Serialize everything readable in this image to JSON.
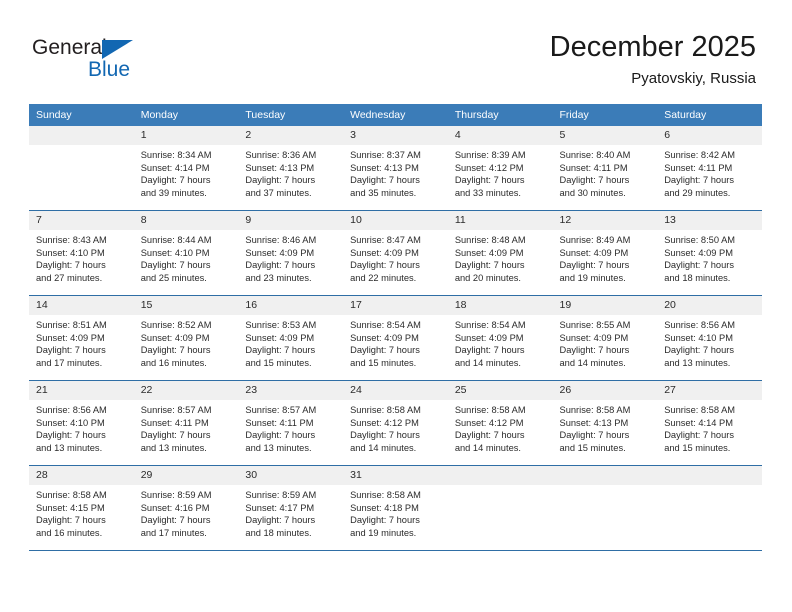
{
  "brand": {
    "name_part1": "General",
    "name_part2": "Blue",
    "accent_color": "#1267b2"
  },
  "header": {
    "title": "December 2025",
    "subtitle": "Pyatovskiy, Russia"
  },
  "calendar": {
    "header_bg": "#3b7cb8",
    "daynum_bg": "#f0f0f0",
    "separator_color": "#2f6ea5",
    "weekday_headers": [
      "Sunday",
      "Monday",
      "Tuesday",
      "Wednesday",
      "Thursday",
      "Friday",
      "Saturday"
    ],
    "weeks": [
      [
        {
          "day": "",
          "sunrise": "",
          "sunset": "",
          "daylight_line1": "",
          "daylight_line2": ""
        },
        {
          "day": "1",
          "sunrise": "Sunrise: 8:34 AM",
          "sunset": "Sunset: 4:14 PM",
          "daylight_line1": "Daylight: 7 hours",
          "daylight_line2": "and 39 minutes."
        },
        {
          "day": "2",
          "sunrise": "Sunrise: 8:36 AM",
          "sunset": "Sunset: 4:13 PM",
          "daylight_line1": "Daylight: 7 hours",
          "daylight_line2": "and 37 minutes."
        },
        {
          "day": "3",
          "sunrise": "Sunrise: 8:37 AM",
          "sunset": "Sunset: 4:13 PM",
          "daylight_line1": "Daylight: 7 hours",
          "daylight_line2": "and 35 minutes."
        },
        {
          "day": "4",
          "sunrise": "Sunrise: 8:39 AM",
          "sunset": "Sunset: 4:12 PM",
          "daylight_line1": "Daylight: 7 hours",
          "daylight_line2": "and 33 minutes."
        },
        {
          "day": "5",
          "sunrise": "Sunrise: 8:40 AM",
          "sunset": "Sunset: 4:11 PM",
          "daylight_line1": "Daylight: 7 hours",
          "daylight_line2": "and 30 minutes."
        },
        {
          "day": "6",
          "sunrise": "Sunrise: 8:42 AM",
          "sunset": "Sunset: 4:11 PM",
          "daylight_line1": "Daylight: 7 hours",
          "daylight_line2": "and 29 minutes."
        }
      ],
      [
        {
          "day": "7",
          "sunrise": "Sunrise: 8:43 AM",
          "sunset": "Sunset: 4:10 PM",
          "daylight_line1": "Daylight: 7 hours",
          "daylight_line2": "and 27 minutes."
        },
        {
          "day": "8",
          "sunrise": "Sunrise: 8:44 AM",
          "sunset": "Sunset: 4:10 PM",
          "daylight_line1": "Daylight: 7 hours",
          "daylight_line2": "and 25 minutes."
        },
        {
          "day": "9",
          "sunrise": "Sunrise: 8:46 AM",
          "sunset": "Sunset: 4:09 PM",
          "daylight_line1": "Daylight: 7 hours",
          "daylight_line2": "and 23 minutes."
        },
        {
          "day": "10",
          "sunrise": "Sunrise: 8:47 AM",
          "sunset": "Sunset: 4:09 PM",
          "daylight_line1": "Daylight: 7 hours",
          "daylight_line2": "and 22 minutes."
        },
        {
          "day": "11",
          "sunrise": "Sunrise: 8:48 AM",
          "sunset": "Sunset: 4:09 PM",
          "daylight_line1": "Daylight: 7 hours",
          "daylight_line2": "and 20 minutes."
        },
        {
          "day": "12",
          "sunrise": "Sunrise: 8:49 AM",
          "sunset": "Sunset: 4:09 PM",
          "daylight_line1": "Daylight: 7 hours",
          "daylight_line2": "and 19 minutes."
        },
        {
          "day": "13",
          "sunrise": "Sunrise: 8:50 AM",
          "sunset": "Sunset: 4:09 PM",
          "daylight_line1": "Daylight: 7 hours",
          "daylight_line2": "and 18 minutes."
        }
      ],
      [
        {
          "day": "14",
          "sunrise": "Sunrise: 8:51 AM",
          "sunset": "Sunset: 4:09 PM",
          "daylight_line1": "Daylight: 7 hours",
          "daylight_line2": "and 17 minutes."
        },
        {
          "day": "15",
          "sunrise": "Sunrise: 8:52 AM",
          "sunset": "Sunset: 4:09 PM",
          "daylight_line1": "Daylight: 7 hours",
          "daylight_line2": "and 16 minutes."
        },
        {
          "day": "16",
          "sunrise": "Sunrise: 8:53 AM",
          "sunset": "Sunset: 4:09 PM",
          "daylight_line1": "Daylight: 7 hours",
          "daylight_line2": "and 15 minutes."
        },
        {
          "day": "17",
          "sunrise": "Sunrise: 8:54 AM",
          "sunset": "Sunset: 4:09 PM",
          "daylight_line1": "Daylight: 7 hours",
          "daylight_line2": "and 15 minutes."
        },
        {
          "day": "18",
          "sunrise": "Sunrise: 8:54 AM",
          "sunset": "Sunset: 4:09 PM",
          "daylight_line1": "Daylight: 7 hours",
          "daylight_line2": "and 14 minutes."
        },
        {
          "day": "19",
          "sunrise": "Sunrise: 8:55 AM",
          "sunset": "Sunset: 4:09 PM",
          "daylight_line1": "Daylight: 7 hours",
          "daylight_line2": "and 14 minutes."
        },
        {
          "day": "20",
          "sunrise": "Sunrise: 8:56 AM",
          "sunset": "Sunset: 4:10 PM",
          "daylight_line1": "Daylight: 7 hours",
          "daylight_line2": "and 13 minutes."
        }
      ],
      [
        {
          "day": "21",
          "sunrise": "Sunrise: 8:56 AM",
          "sunset": "Sunset: 4:10 PM",
          "daylight_line1": "Daylight: 7 hours",
          "daylight_line2": "and 13 minutes."
        },
        {
          "day": "22",
          "sunrise": "Sunrise: 8:57 AM",
          "sunset": "Sunset: 4:11 PM",
          "daylight_line1": "Daylight: 7 hours",
          "daylight_line2": "and 13 minutes."
        },
        {
          "day": "23",
          "sunrise": "Sunrise: 8:57 AM",
          "sunset": "Sunset: 4:11 PM",
          "daylight_line1": "Daylight: 7 hours",
          "daylight_line2": "and 13 minutes."
        },
        {
          "day": "24",
          "sunrise": "Sunrise: 8:58 AM",
          "sunset": "Sunset: 4:12 PM",
          "daylight_line1": "Daylight: 7 hours",
          "daylight_line2": "and 14 minutes."
        },
        {
          "day": "25",
          "sunrise": "Sunrise: 8:58 AM",
          "sunset": "Sunset: 4:12 PM",
          "daylight_line1": "Daylight: 7 hours",
          "daylight_line2": "and 14 minutes."
        },
        {
          "day": "26",
          "sunrise": "Sunrise: 8:58 AM",
          "sunset": "Sunset: 4:13 PM",
          "daylight_line1": "Daylight: 7 hours",
          "daylight_line2": "and 15 minutes."
        },
        {
          "day": "27",
          "sunrise": "Sunrise: 8:58 AM",
          "sunset": "Sunset: 4:14 PM",
          "daylight_line1": "Daylight: 7 hours",
          "daylight_line2": "and 15 minutes."
        }
      ],
      [
        {
          "day": "28",
          "sunrise": "Sunrise: 8:58 AM",
          "sunset": "Sunset: 4:15 PM",
          "daylight_line1": "Daylight: 7 hours",
          "daylight_line2": "and 16 minutes."
        },
        {
          "day": "29",
          "sunrise": "Sunrise: 8:59 AM",
          "sunset": "Sunset: 4:16 PM",
          "daylight_line1": "Daylight: 7 hours",
          "daylight_line2": "and 17 minutes."
        },
        {
          "day": "30",
          "sunrise": "Sunrise: 8:59 AM",
          "sunset": "Sunset: 4:17 PM",
          "daylight_line1": "Daylight: 7 hours",
          "daylight_line2": "and 18 minutes."
        },
        {
          "day": "31",
          "sunrise": "Sunrise: 8:58 AM",
          "sunset": "Sunset: 4:18 PM",
          "daylight_line1": "Daylight: 7 hours",
          "daylight_line2": "and 19 minutes."
        },
        {
          "day": "",
          "sunrise": "",
          "sunset": "",
          "daylight_line1": "",
          "daylight_line2": ""
        },
        {
          "day": "",
          "sunrise": "",
          "sunset": "",
          "daylight_line1": "",
          "daylight_line2": ""
        },
        {
          "day": "",
          "sunrise": "",
          "sunset": "",
          "daylight_line1": "",
          "daylight_line2": ""
        }
      ]
    ]
  }
}
